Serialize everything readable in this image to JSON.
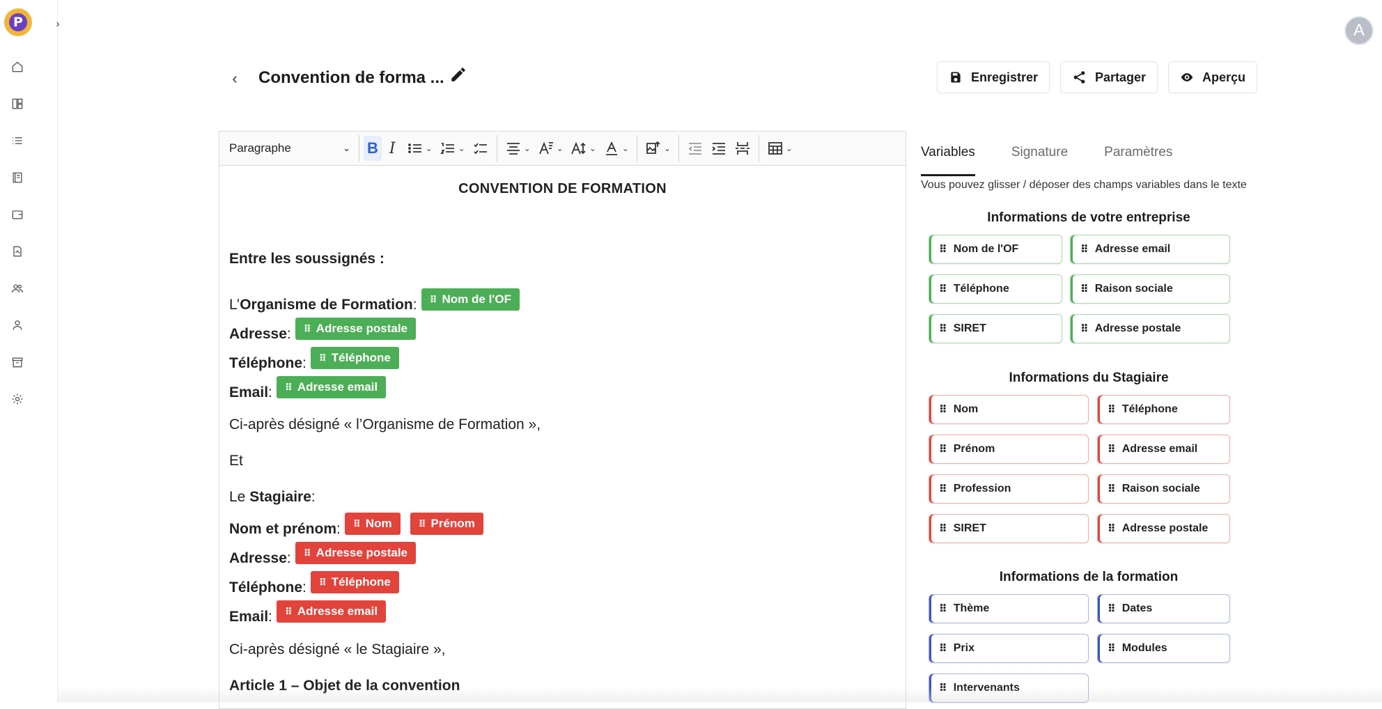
{
  "app": {
    "logo_letter": "P",
    "avatar_letter": "A"
  },
  "sidebar": {
    "items": [
      {
        "name": "home-icon"
      },
      {
        "name": "layout-icon"
      },
      {
        "name": "list-icon"
      },
      {
        "name": "book-icon"
      },
      {
        "name": "wallet-icon"
      },
      {
        "name": "document-sign-icon"
      },
      {
        "name": "users-icon"
      },
      {
        "name": "user-icon"
      },
      {
        "name": "archive-icon"
      },
      {
        "name": "settings-icon"
      }
    ]
  },
  "header": {
    "title": "Convention de forma ...",
    "save_label": "Enregistrer",
    "share_label": "Partager",
    "preview_label": "Aperçu"
  },
  "toolbar": {
    "paragraph_style": "Paragraphe"
  },
  "document": {
    "heading": "CONVENTION DE FORMATION",
    "between": "Entre les soussignés :",
    "org_prefix": "L’",
    "org_label": "Organisme de Formation",
    "colon": " :",
    "address_label": "Adresse",
    "phone_label": "Téléphone",
    "email_label": "Email",
    "org_designated": "Ci-après désigné « l’Organisme de Formation »,",
    "and": "Et",
    "trainee_prefix": "Le ",
    "trainee_label": "Stagiaire",
    "name_label": "Nom et prénom",
    "trainee_designated": "Ci-après désigné « le Stagiaire »,",
    "article1": "Article 1 – Objet de la convention",
    "chips": {
      "org_name": "Nom de l'OF",
      "org_address": "Adresse postale",
      "org_phone": "Téléphone",
      "org_email": "Adresse email",
      "trainee_last": "Nom",
      "trainee_first": "Prénom",
      "trainee_address": "Adresse postale",
      "trainee_phone": "Téléphone",
      "trainee_email": "Adresse email"
    }
  },
  "panel": {
    "tabs": [
      "Variables",
      "Signature",
      "Paramètres"
    ],
    "hint": "Vous pouvez glisser / déposer des champs variables dans le texte",
    "groups": [
      {
        "title": "Informations de votre entreprise",
        "color": "green",
        "items": [
          "Nom de l'OF",
          "Adresse email",
          "Téléphone",
          "Raison sociale",
          "SIRET",
          "Adresse postale"
        ]
      },
      {
        "title": "Informations du Stagiaire",
        "color": "red",
        "items": [
          "Nom",
          "Téléphone",
          "Prénom",
          "Adresse email",
          "Profession",
          "Raison sociale",
          "SIRET",
          "Adresse postale"
        ]
      },
      {
        "title": "Informations de la formation",
        "color": "blue",
        "items": [
          "Thème",
          "Dates",
          "Prix",
          "Modules",
          "Intervenants"
        ]
      }
    ]
  },
  "colors": {
    "green": "#4cae56",
    "red": "#e2433b",
    "blue": "#3e53c9",
    "logo_bg": "#f2b53a",
    "logo_fg": "#6a3fc4"
  }
}
